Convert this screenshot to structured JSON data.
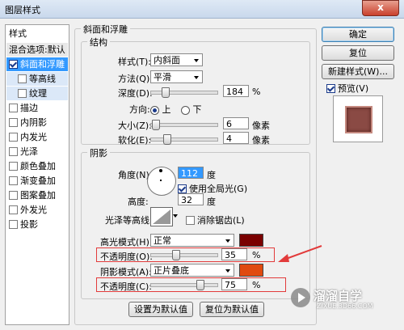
{
  "window": {
    "title": "图层样式",
    "close_glyph": "x"
  },
  "left_panel": {
    "header": "样式",
    "items": [
      {
        "label": "混合选项:默认",
        "checkbox": false,
        "checked": false
      },
      {
        "label": "斜面和浮雕",
        "checkbox": true,
        "checked": true
      },
      {
        "label": "等高线",
        "checkbox": true,
        "checked": false
      },
      {
        "label": "纹理",
        "checkbox": true,
        "checked": false
      },
      {
        "label": "描边",
        "checkbox": true,
        "checked": false
      },
      {
        "label": "内阴影",
        "checkbox": true,
        "checked": false
      },
      {
        "label": "内发光",
        "checkbox": true,
        "checked": false
      },
      {
        "label": "光泽",
        "checkbox": true,
        "checked": false
      },
      {
        "label": "颜色叠加",
        "checkbox": true,
        "checked": false
      },
      {
        "label": "渐变叠加",
        "checkbox": true,
        "checked": false
      },
      {
        "label": "图案叠加",
        "checkbox": true,
        "checked": false
      },
      {
        "label": "外发光",
        "checkbox": true,
        "checked": false
      },
      {
        "label": "投影",
        "checkbox": true,
        "checked": false
      }
    ]
  },
  "bevel": {
    "group_title": "斜面和浮雕",
    "structure": {
      "title": "结构",
      "style_label": "样式(T):",
      "style_value": "内斜面",
      "method_label": "方法(Q):",
      "method_value": "平滑",
      "depth_label": "深度(D):",
      "depth_value": "184",
      "depth_unit": "%",
      "depth_level": 0.18,
      "direction_label": "方向:",
      "dir_up": "上",
      "dir_down": "下",
      "dir_selected": "上",
      "size_label": "大小(Z):",
      "size_value": "6",
      "size_unit": "像素",
      "size_level": 0.02,
      "soften_label": "软化(E):",
      "soften_value": "4",
      "soften_unit": "像素",
      "soften_level": 0.2
    },
    "shading": {
      "title": "阴影",
      "angle_label": "角度(N):",
      "angle_value": "112",
      "angle_unit": "度",
      "global_light_label": "使用全局光(G)",
      "global_light": true,
      "altitude_label": "高度:",
      "altitude_value": "32",
      "altitude_unit": "度",
      "gloss_label": "光泽等高线:",
      "antialias_label": "消除锯齿(L)",
      "antialias": false,
      "highlight_mode_label": "高光模式(H):",
      "highlight_mode": "正常",
      "highlight_color": "#7a0000",
      "highlight_opacity_label": "不透明度(O):",
      "highlight_opacity": "35",
      "highlight_opacity_unit": "%",
      "highlight_opacity_level": 0.35,
      "shadow_mode_label": "阴影模式(A):",
      "shadow_mode": "正片叠底",
      "shadow_color": "#e04a10",
      "shadow_opacity_label": "不透明度(C):",
      "shadow_opacity": "75",
      "shadow_opacity_unit": "%",
      "shadow_opacity_level": 0.75
    },
    "set_default": "设置为默认值",
    "reset_default": "复位为默认值"
  },
  "buttons": {
    "ok": "确定",
    "reset": "复位",
    "new_style": "新建样式(W)...",
    "preview_label": "预览(V)",
    "preview": true
  },
  "watermark": {
    "name": "溜溜自学",
    "url": "ZIXUE.3D66.COM"
  }
}
